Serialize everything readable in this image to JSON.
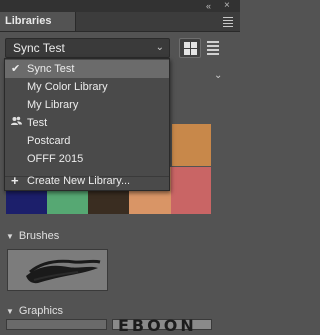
{
  "panel": {
    "tab_label": "Libraries",
    "close_glyph": "×",
    "collapse_glyph": "«"
  },
  "library_select": {
    "value": "Sync Test",
    "chevron": "⌄"
  },
  "dropdown": {
    "items": [
      {
        "label": "Sync Test",
        "selected": true,
        "icon": "checkmark-icon"
      },
      {
        "label": "My Color Library"
      },
      {
        "label": "My Library"
      },
      {
        "label": "Test",
        "icon": "shared-users-icon"
      },
      {
        "label": "Postcard"
      },
      {
        "label": "OFFF 2015"
      }
    ],
    "create_label": "Create New Library...",
    "create_icon": "plus-icon"
  },
  "colors": {
    "row1": [
      "#7a7a7a",
      "#7a7a7a",
      "#7a7a7a",
      "#7a7a7a",
      "#c8884a"
    ],
    "row2": [
      "#1c1f6b",
      "#56a873",
      "#3a2d21",
      "#d99566",
      "#c96565"
    ]
  },
  "sections": {
    "brushes": "Brushes",
    "graphics": "Graphics"
  },
  "graphics_partial_text": "EBOON"
}
